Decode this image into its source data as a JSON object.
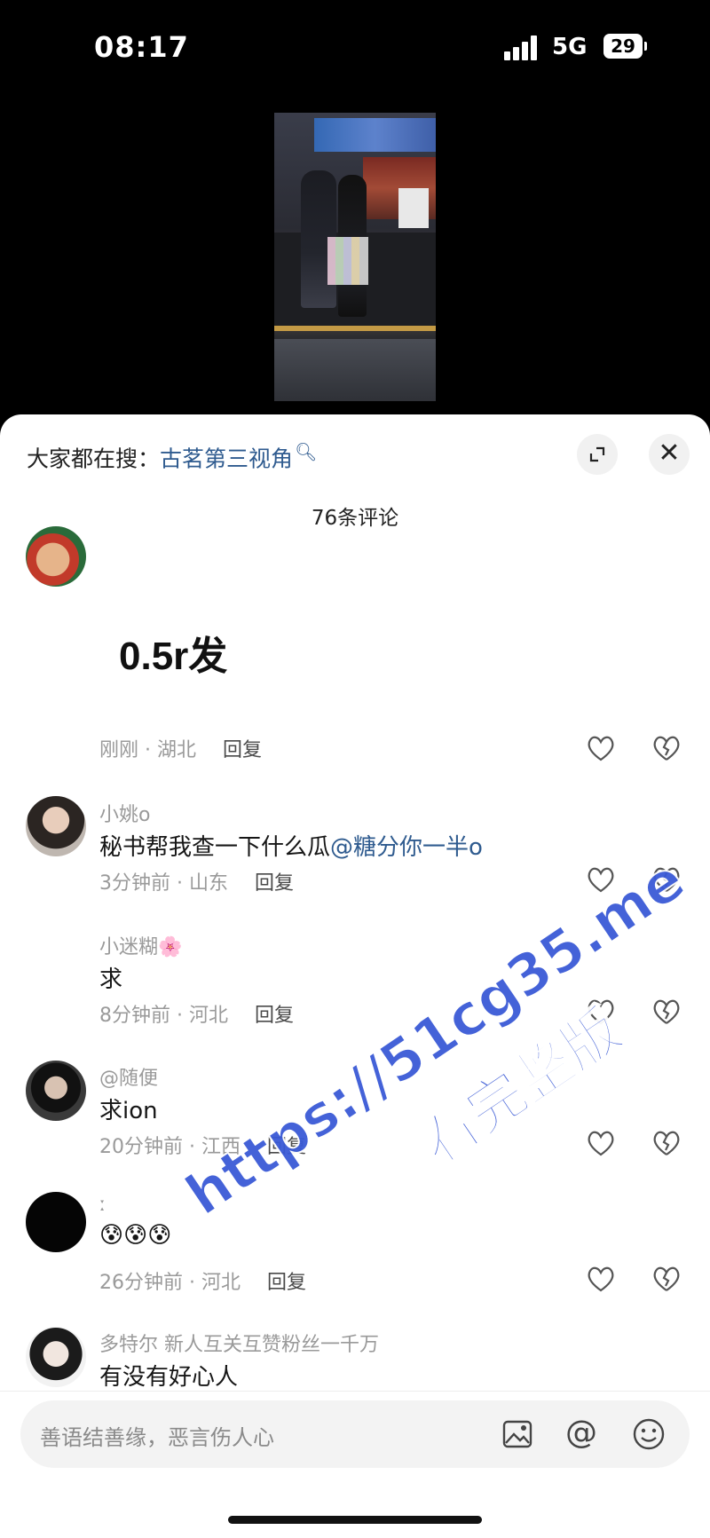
{
  "status_bar": {
    "time": "08:17",
    "network": "5G",
    "battery": "29"
  },
  "search": {
    "prefix": "大家都在搜：",
    "keyword": "古茗第三视角"
  },
  "comments_header": {
    "count_label": "76条评论"
  },
  "comments": [
    {
      "username": "",
      "text": "0.5r发",
      "time": "刚刚",
      "region": "湖北",
      "reply_label": "回复"
    },
    {
      "username": "小姚o",
      "text": "秘书帮我查一下什么瓜",
      "mention": "@糖分你一半o",
      "time": "3分钟前",
      "region": "山东",
      "reply_label": "回复"
    },
    {
      "username": "小迷糊🌸",
      "text": "求",
      "time": "8分钟前",
      "region": "河北",
      "reply_label": "回复"
    },
    {
      "username": "@随便",
      "text": "求ion",
      "time": "20分钟前",
      "region": "江西",
      "reply_label": "回复"
    },
    {
      "username": "ː",
      "text": "😰😰😰",
      "time": "26分钟前",
      "region": "河北",
      "reply_label": "回复"
    },
    {
      "username": "多特尔 新人互关互赞粉丝一千万",
      "text": "有没有好心人"
    }
  ],
  "input": {
    "placeholder": "善语结善缘，恶言伤人心"
  },
  "watermark": {
    "line1": "https://51cg35.me",
    "line2": "看完整版"
  },
  "icons": {
    "expand": "expand-icon",
    "close": "close-icon",
    "like": "heart-icon",
    "dislike": "broken-heart-icon",
    "image": "image-icon",
    "mention": "at-icon",
    "emoji": "emoji-icon"
  },
  "colors": {
    "accent": "#2f5b8f",
    "watermark": "#3a5ad6"
  }
}
